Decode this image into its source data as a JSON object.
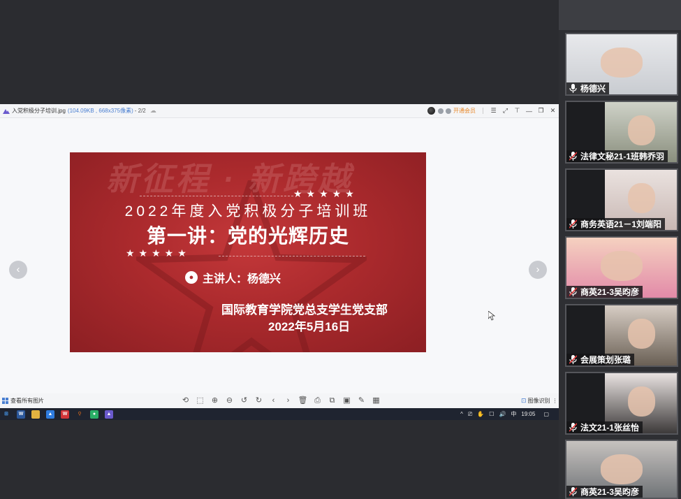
{
  "viewer": {
    "filename": "入党积极分子培训.jpg",
    "file_meta": "(104.09KB , 668x375像素)",
    "page_counter": "- 2/2",
    "vip_label": "开通会员",
    "window_buttons": [
      "☰",
      "⤢",
      "⊤",
      "—",
      "❐",
      "✕"
    ]
  },
  "slide": {
    "watermark": "新征程 · 新跨越",
    "stars_top": "★★★★★",
    "title_line1": "2022年度入党积极分子培训班",
    "title_line2": "第一讲：党的光辉历史",
    "stars_bottom": "★★★★★",
    "speaker": "主讲人：杨德兴",
    "organizer": "国际教育学院党总支学生党支部",
    "date": "2022年5月16日"
  },
  "toolbar": {
    "view_all_label": "查看所有图片",
    "tool_icons": [
      "⟲",
      "⬚",
      "⊕",
      "⊖",
      "↺",
      "↻",
      "‹",
      "›",
      "🗑",
      "⎙",
      "⧉",
      "▣",
      "✎",
      "▦"
    ],
    "right_label": "图像识别",
    "more_label": "⋮"
  },
  "taskbar": {
    "apps": [
      {
        "name": "start",
        "glyph": "⊞",
        "color": "#1f2430"
      },
      {
        "name": "word",
        "glyph": "W",
        "color": "#2b579a"
      },
      {
        "name": "explorer",
        "glyph": "▬",
        "color": "#e3b341"
      },
      {
        "name": "photos",
        "glyph": "▲",
        "color": "#2f7de1"
      },
      {
        "name": "wps",
        "glyph": "W",
        "color": "#d13438"
      },
      {
        "name": "search",
        "glyph": "⚲",
        "color": "#e06c1a"
      },
      {
        "name": "wechat",
        "glyph": "●",
        "color": "#2aae67"
      },
      {
        "name": "image-viewer",
        "glyph": "▲",
        "color": "#6a5acd"
      }
    ],
    "tray_icons": [
      "^",
      "⎚",
      "✋",
      "☐",
      "🔊"
    ],
    "ime": "中",
    "time": "19:05",
    "notification": "▢"
  },
  "participants": [
    {
      "name": "杨德兴",
      "muted": false,
      "colors": [
        "#c9ccd1",
        "#e8e9ec"
      ]
    },
    {
      "name": "法律文秘21-1班韩乔羽",
      "muted": true,
      "colors": [
        "#8a8f7e",
        "#cfd2c8"
      ]
    },
    {
      "name": "商务英语21－1刘端阳",
      "muted": true,
      "colors": [
        "#c9b8b4",
        "#eae2df"
      ]
    },
    {
      "name": "商英21-3吴昀彦",
      "muted": true,
      "colors": [
        "#e28aa8",
        "#f5d1c0"
      ]
    },
    {
      "name": "会展策划张璐",
      "muted": true,
      "colors": [
        "#6a6055",
        "#d7cdc4"
      ]
    },
    {
      "name": "法文21-1张丝怡",
      "muted": true,
      "colors": [
        "#3d3a3a",
        "#e9e3e1"
      ]
    },
    {
      "name": "商英21-3吴昀彦",
      "muted": true,
      "colors": [
        "#6b6f73",
        "#c6c2bf"
      ]
    }
  ],
  "colors": {
    "slide_red": "#ab2a2d",
    "accent_blue": "#4a7fd1",
    "vip_orange": "#e8882a",
    "muted_red": "#e23a3a"
  }
}
